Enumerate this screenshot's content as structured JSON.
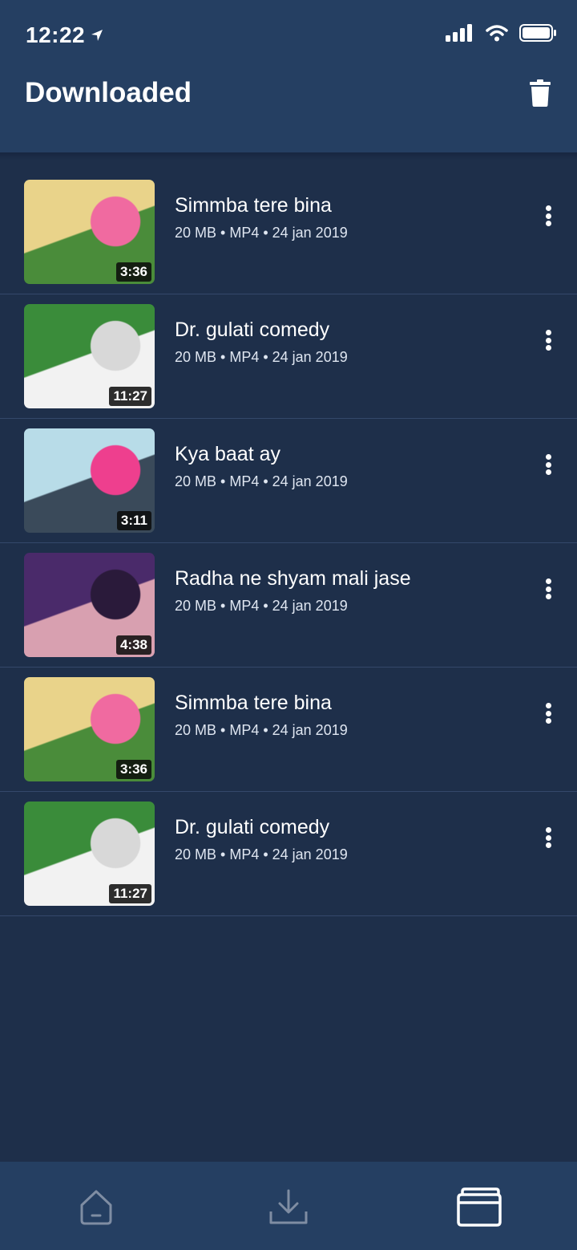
{
  "status_bar": {
    "time": "12:22"
  },
  "header": {
    "title": "Downloaded"
  },
  "videos": [
    {
      "title": "Simmba tere bina",
      "meta": "20 MB  • MP4 • 24 jan 2019",
      "duration": "3:36",
      "thumb_colors": [
        "#e9d38a",
        "#f06aa0",
        "#4a8c3a"
      ]
    },
    {
      "title": "Dr. gulati comedy",
      "meta": "20 MB  • MP4 • 24 jan 2019",
      "duration": "11:27",
      "thumb_colors": [
        "#3a8c3a",
        "#d8d8d8",
        "#f2f2f2"
      ]
    },
    {
      "title": "Kya baat ay",
      "meta": "20 MB • MP4 • 24 jan 2019",
      "duration": "3:11",
      "thumb_colors": [
        "#b8dce8",
        "#ee3f8e",
        "#3a4a5a"
      ]
    },
    {
      "title": "Radha ne shyam mali jase",
      "meta": "20 MB • MP4 • 24 jan 2019",
      "duration": "4:38",
      "thumb_colors": [
        "#4a2a6a",
        "#2a1a3a",
        "#d8a0b0"
      ]
    },
    {
      "title": "Simmba tere bina",
      "meta": "20 MB • MP4 • 24 jan 2019",
      "duration": "3:36",
      "thumb_colors": [
        "#e9d38a",
        "#f06aa0",
        "#4a8c3a"
      ]
    },
    {
      "title": "Dr. gulati comedy",
      "meta": "20 MB • MP4 • 24 jan 2019",
      "duration": "11:27",
      "thumb_colors": [
        "#3a8c3a",
        "#d8d8d8",
        "#f2f2f2"
      ]
    }
  ],
  "tabs": [
    {
      "icon": "home-icon",
      "active": false
    },
    {
      "icon": "download-icon",
      "active": false
    },
    {
      "icon": "folder-icon",
      "active": true
    }
  ],
  "colors": {
    "background": "#1e2f4a",
    "header": "#253f62",
    "divider": "#34486a",
    "inactive_icon": "#7f8da3",
    "active_icon": "#ffffff"
  }
}
